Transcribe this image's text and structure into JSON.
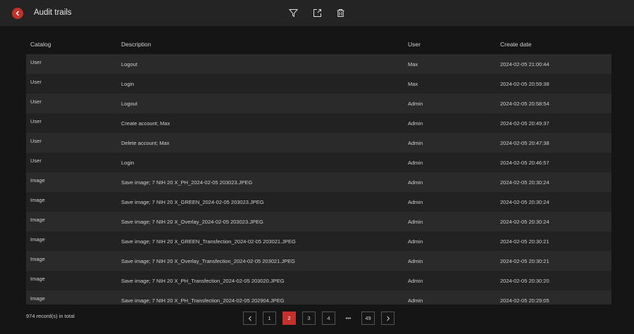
{
  "header": {
    "title": "Audit trails",
    "icons": [
      "back-icon",
      "filter-icon",
      "export-icon",
      "delete-icon"
    ]
  },
  "table": {
    "columns": [
      "Catalog",
      "Description",
      "User",
      "Create date"
    ],
    "rows": [
      [
        "User",
        "Logout",
        "Max",
        "2024-02-05 21:00:44"
      ],
      [
        "User",
        "Login",
        "Max",
        "2024-02-05 20:59:38"
      ],
      [
        "User",
        "Logout",
        "Admin",
        "2024-02-05 20:58:54"
      ],
      [
        "User",
        "Create account; Max",
        "Admin",
        "2024-02-05 20:49:37"
      ],
      [
        "User",
        "Delete account; Max",
        "Admin",
        "2024-02-05 20:47:38"
      ],
      [
        "User",
        "Login",
        "Admin",
        "2024-02-05 20:46:57"
      ],
      [
        "Image",
        "Save image; 7 NIH 20 X_PH_2024-02-05 203023.JPEG",
        "Admin",
        "2024-02-05 20:30:24"
      ],
      [
        "Image",
        "Save image; 7 NIH 20 X_GREEN_2024-02-05 203023.JPEG",
        "Admin",
        "2024-02-05 20:30:24"
      ],
      [
        "Image",
        "Save image; 7 NIH 20 X_Overlay_2024-02-05 203023.JPEG",
        "Admin",
        "2024-02-05 20:30:24"
      ],
      [
        "Image",
        "Save image; 7 NIH 20 X_GREEN_Transfection_2024-02-05 203021.JPEG",
        "Admin",
        "2024-02-05 20:30:21"
      ],
      [
        "Image",
        "Save image; 7 NIH 20 X_Overlay_Transfection_2024-02-05 203021.JPEG",
        "Admin",
        "2024-02-05 20:30:21"
      ],
      [
        "Image",
        "Save image; 7 NIH 20 X_PH_Transfection_2024-02-05 203020.JPEG",
        "Admin",
        "2024-02-05 20:30:20"
      ],
      [
        "Image",
        "Save image; 7 NIH 20 X_PH_Transfection_2024-02-05 202904.JPEG",
        "Admin",
        "2024-02-05 20:29:05"
      ]
    ]
  },
  "footer": {
    "total": "974 record(s) in total",
    "pages": [
      "1",
      "2",
      "3",
      "4",
      "•••",
      "49"
    ],
    "current": "2",
    "accent": "#c4302b"
  }
}
